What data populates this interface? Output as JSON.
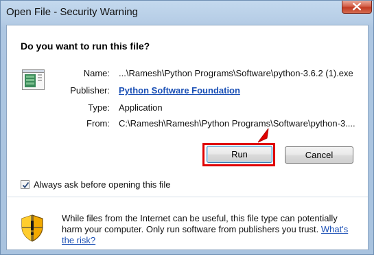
{
  "window": {
    "title": "Open File - Security Warning"
  },
  "dialog": {
    "heading": "Do you want to run this file?",
    "fields": [
      {
        "label": "Name:",
        "value": "...\\Ramesh\\Python Programs\\Software\\python-3.6.2 (1).exe"
      },
      {
        "label": "Publisher:",
        "value": "Python Software Foundation"
      },
      {
        "label": "Type:",
        "value": "Application"
      },
      {
        "label": "From:",
        "value": "C:\\Ramesh\\Ramesh\\Python Programs\\Software\\python-3...."
      }
    ],
    "run_label": "Run",
    "cancel_label": "Cancel",
    "checkbox_label": "Always ask before opening this file",
    "checkbox_checked": true,
    "warning_text": "While files from the Internet can be useful, this file type can potentially harm your computer. Only run software from publishers you trust.",
    "warning_link": "What's the risk?"
  },
  "icons": {
    "close": "close-icon",
    "file": "application-file-icon",
    "shield": "security-shield-icon",
    "arrow": "red-pointer-arrow",
    "check": "checkmark-icon"
  },
  "colors": {
    "highlight": "#e00000",
    "link": "#1a4fb5",
    "close_button": "#c23b22"
  }
}
